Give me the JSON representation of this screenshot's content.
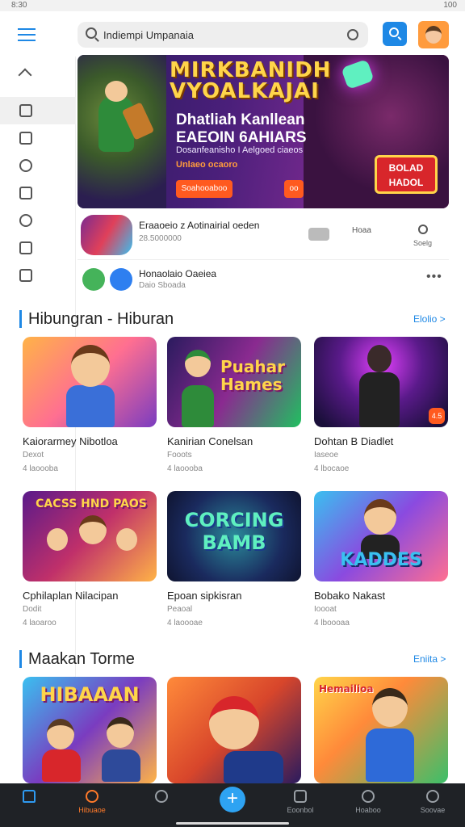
{
  "statusbar": {
    "time": "8:30",
    "right": "100"
  },
  "search": {
    "placeholder": "Indiempi Umpanaia"
  },
  "banner": {
    "title_line1": "MIRKBANIDH",
    "title_line2": "VYOALKAJAI",
    "subtitle_line1": "Dhatliah Kanllean",
    "subtitle_line2": "EAEOIN 6AHIARS",
    "description": "Dosanfeanisho I Aelgoed ciaeos",
    "tag": "Unlaeo ocaoro",
    "button1": "Soahooaboo",
    "button2": "oo",
    "logo_text": "BOLAD HADOL"
  },
  "featured": {
    "title": "Eraaoeio z Aotinairial oeden",
    "subtitle": "28.5000000",
    "action2_label": "Hoaa",
    "action3_label": "Soelg"
  },
  "secondary": {
    "title": "Honaolaio Oaeiea",
    "subtitle": "Daio Sboada",
    "more": "•••"
  },
  "section1": {
    "title": "Hibungran - Hiburan",
    "link": "Elolio >",
    "cards": [
      {
        "name": "Kaiorarmey Nibotloa",
        "meta1": "Dexot",
        "meta2": "4 laoooba"
      },
      {
        "name": "Kanirian Conelsan",
        "meta1": "Fooots",
        "meta2": "4 laoooba"
      },
      {
        "name": "Dohtan B Diadlet",
        "meta1": "Iaseoe",
        "meta2": "4 lbocaoe"
      },
      {
        "name": "Cphilaplan Nilacipan",
        "meta1": "Dodit",
        "meta2": "4 laoaroo"
      },
      {
        "name": "Epoan sipkisran",
        "meta1": "Peaoal",
        "meta2": "4 laoooae"
      },
      {
        "name": "Bobako Nakast",
        "meta1": "Ioooat",
        "meta2": "4 lboooaa"
      }
    ],
    "card_art": [
      {
        "label": "",
        "badge": ""
      },
      {
        "label": "Puahar Hames",
        "badge": ""
      },
      {
        "label": "",
        "badge": "4.5"
      },
      {
        "label": "CACSS HND PAOS",
        "badge": ""
      },
      {
        "label": "CORCING BAMB",
        "badge": ""
      },
      {
        "label": "KADDES",
        "badge": ""
      }
    ]
  },
  "section2": {
    "title": "Maakan Torme",
    "link": "Eniita >",
    "cards": [
      {
        "label": "HIBAAAN"
      },
      {
        "label": ""
      },
      {
        "label": "Hemailioa"
      }
    ]
  },
  "bottom_nav": [
    {
      "label": ""
    },
    {
      "label": "Hibuaoe"
    },
    {
      "label": ""
    },
    {
      "label": ""
    },
    {
      "label": "Eoonbol"
    },
    {
      "label": "Hoaboo"
    },
    {
      "label": "Soovae"
    }
  ],
  "colors": {
    "accent": "#1e88e5",
    "orange": "#ff7a2a",
    "nav_bg": "#1f2226"
  }
}
